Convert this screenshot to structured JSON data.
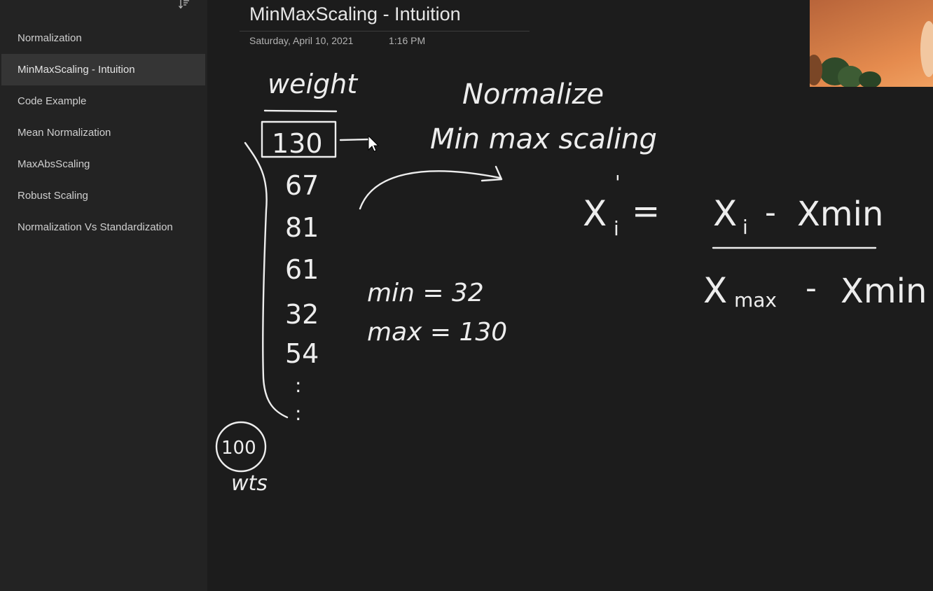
{
  "notebook": {
    "sort_icon": "sort-icon",
    "pages": [
      {
        "label": "Normalization",
        "active": false
      },
      {
        "label": "MinMaxScaling - Intuition",
        "active": true
      },
      {
        "label": "Code Example",
        "active": false
      },
      {
        "label": "Mean Normalization",
        "active": false
      },
      {
        "label": "MaxAbsScaling",
        "active": false
      },
      {
        "label": "Robust Scaling",
        "active": false
      },
      {
        "label": "Normalization Vs Standardization",
        "active": false
      }
    ]
  },
  "page": {
    "title": "MinMaxScaling - Intuition",
    "date": "Saturday, April 10, 2021",
    "time": "1:16 PM"
  },
  "ink": {
    "column_header": "weight",
    "values": [
      "130",
      "67",
      "81",
      "61",
      "32",
      "54"
    ],
    "ellipsis": ":",
    "count_circle": "100",
    "count_label": "wts",
    "heading_1": "Normalize",
    "heading_2": "Min max scaling",
    "min_line": "min = 32",
    "max_line": "max = 130",
    "formula": {
      "lhs_base": "X",
      "lhs_sub": "i",
      "lhs_prime": "'",
      "equals": "=",
      "numerator_a": "X",
      "numerator_a_sub": "i",
      "numerator_minus": "-",
      "numerator_b": "Xmin",
      "denominator_a": "X",
      "denominator_a_sub": "max",
      "denominator_minus": "-",
      "denominator_b": "Xmin"
    }
  },
  "icons": {
    "cursor": "cursor-icon"
  },
  "colors": {
    "background": "#1c1c1c",
    "sidebar": "#232323",
    "active_item": "#353535",
    "ink": "#ededed"
  }
}
